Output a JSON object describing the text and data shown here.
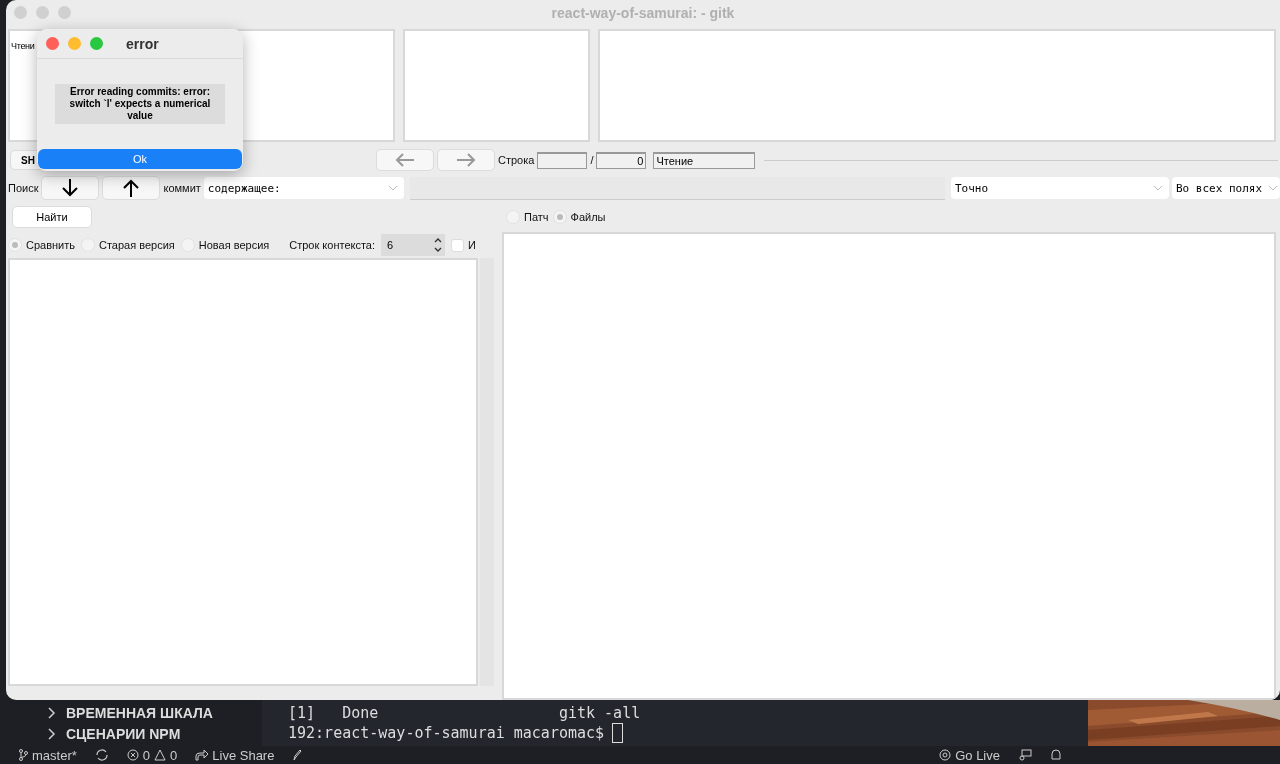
{
  "window": {
    "title": "react-way-of-samurai:  - gitk"
  },
  "commit_panes": {
    "status": "Чтени"
  },
  "toolbar": {
    "sha_label": "SH",
    "row_label": "Строка",
    "separator": "/",
    "row_total": "0",
    "status": "Чтение"
  },
  "search": {
    "label": "Поиск",
    "commit_label": "коммит",
    "mode": "содержащее:",
    "match": "Точно",
    "fields": "Во всех полях",
    "find_button": "Найти"
  },
  "diff_options": {
    "radios": [
      {
        "label": "Сравнить",
        "selected": true
      },
      {
        "label": "Старая версия",
        "selected": false
      },
      {
        "label": "Новая версия",
        "selected": false
      }
    ],
    "context_label": "Строк контекста:",
    "context_value": "6",
    "ignore": {
      "label": "И",
      "checked": false
    }
  },
  "view_mode": [
    {
      "label": "Патч",
      "selected": false
    },
    {
      "label": "Файлы",
      "selected": true
    }
  ],
  "dialog": {
    "title": "error",
    "message": "Error reading commits: error: switch `l' expects a numerical value",
    "button": "Ok"
  },
  "editor": {
    "sidebar_items": [
      "ВРЕМЕННАЯ ШКАЛА",
      "СЦЕНАРИИ NPM"
    ],
    "terminal_lines": [
      "[1]   Done                    gitk -all",
      "192:react-way-of-samurai macaromac$"
    ],
    "status_bar": {
      "branch": "master*",
      "errors": "0",
      "warnings": "0",
      "live_share": "Live Share",
      "go_live": "Go Live"
    }
  }
}
